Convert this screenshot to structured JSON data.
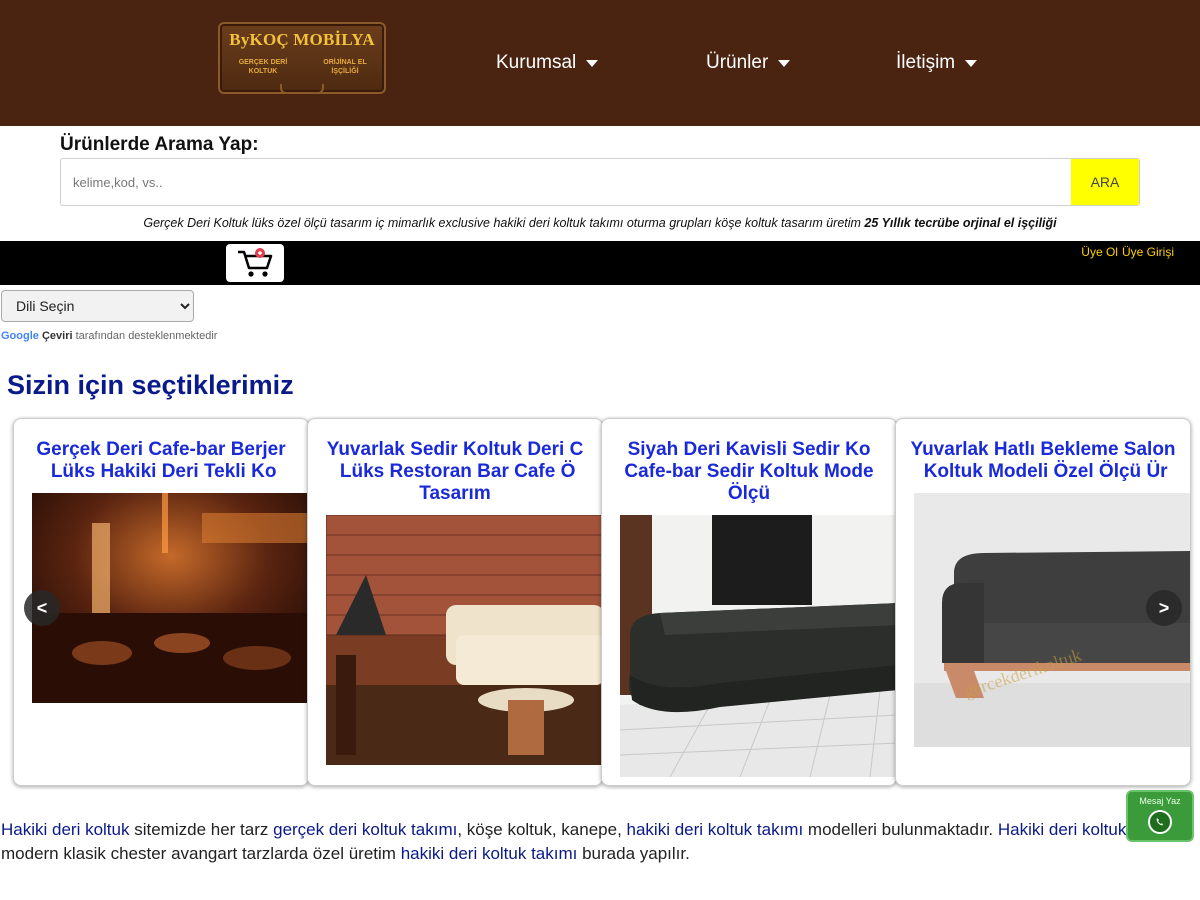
{
  "brand": {
    "title": "ByKOÇ MOBİLYA",
    "sub_left": "GERÇEK DERİ KOLTUK",
    "sub_right": "ORİJİNAL EL İŞÇİLİĞİ",
    "colors": {
      "header_bg": "#4a2410",
      "logo_text": "#f2c33a"
    }
  },
  "nav": {
    "items": [
      {
        "label": "Kurumsal"
      },
      {
        "label": "Ürünler"
      },
      {
        "label": "İletişim"
      }
    ]
  },
  "search": {
    "label": "Ürünlerde Arama Yap:",
    "placeholder": "kelime,kod, vs..",
    "button": "ARA"
  },
  "tagline": {
    "text": "Gerçek Deri Koltuk lüks özel ölçü tasarım iç mimarlık exclusive hakiki deri koltuk takımı oturma grupları köşe koltuk tasarım üretim ",
    "bold": "25 Yıllık tecrübe orjinal el işçiliği"
  },
  "toolbar": {
    "cart_icon": "shopping-cart-icon",
    "register": "Üye Ol",
    "login": "Üye Girişi"
  },
  "language": {
    "selected": "Dili Seçin",
    "powered_google": "Google",
    "powered_ceviri": "Çeviri",
    "powered_rest": "tarafından desteklenmektedir"
  },
  "section": {
    "title": "Sizin için seçtiklerimiz"
  },
  "products": [
    {
      "title": "Gerçek Deri Cafe-bar Berjer\n Lüks Hakiki Deri Tekli Ko"
    },
    {
      "title": "Yuvarlak Sedir Koltuk Deri C\n Lüks Restoran Bar Cafe Ö\nTasarım"
    },
    {
      "title": "Siyah Deri Kavisli Sedir Ko\nCafe-bar Sedir Koltuk Mode\nÖlçü"
    },
    {
      "title": "Yuvarlak Hatlı Bekleme Salon\n Koltuk Modeli Özel Ölçü Ür"
    }
  ],
  "carousel": {
    "prev": "<",
    "next": ">"
  },
  "description": {
    "p1": "Hakiki deri koltuk",
    "p2": " sitemizde her tarz ",
    "p3": "gerçek deri koltuk takımı",
    "p4": ", köşe koltuk, kanepe, ",
    "p5": "hakiki deri koltuk takımı",
    "p6": " modelleri bulunmaktadır. ",
    "p7": "Hakiki deri koltuk",
    "p8": " modern klasik chester avangart tarzlarda özel üretim ",
    "p9": "hakiki deri koltuk takımı",
    "p10": " burada yapılır."
  },
  "whatsapp": {
    "label": "Mesaj Yaz",
    "icon": "whatsapp-icon"
  }
}
